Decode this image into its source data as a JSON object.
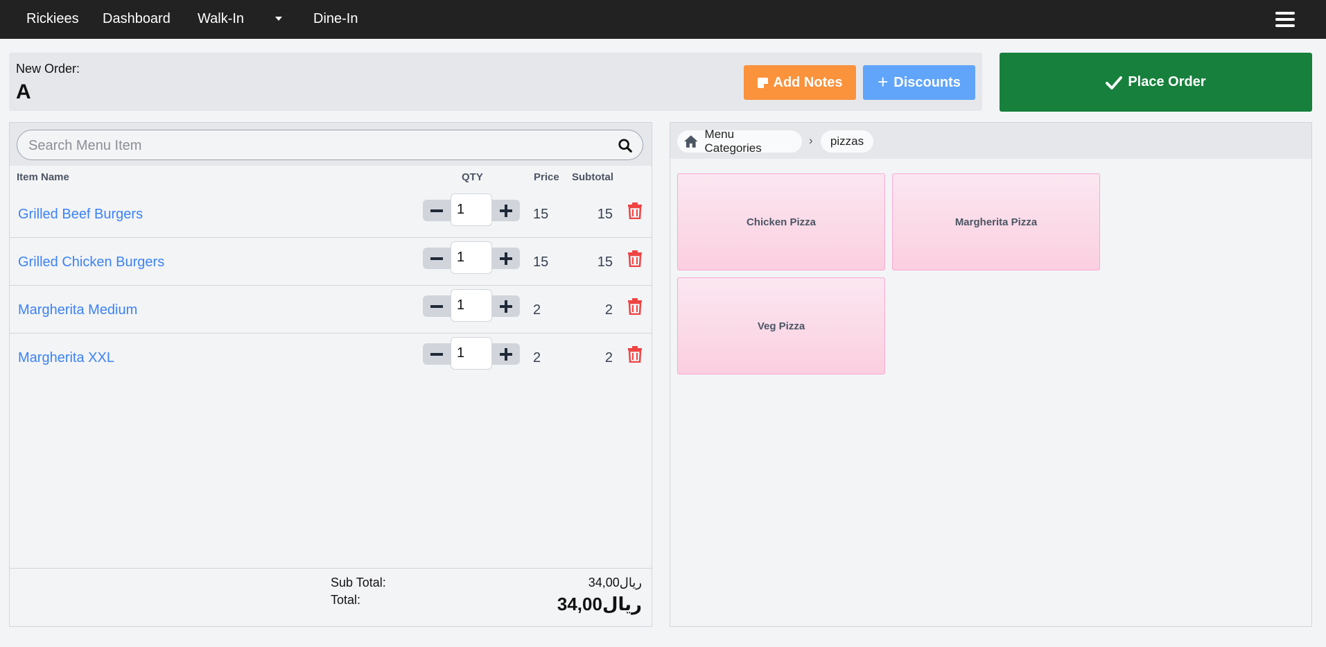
{
  "navbar": {
    "brand": "Rickiees",
    "links": [
      "Dashboard",
      "Walk-In",
      "Dine-In"
    ]
  },
  "order": {
    "label": "New Order:",
    "name": "A"
  },
  "actions": {
    "add_notes": "Add Notes",
    "discounts": "Discounts",
    "place_order": "Place Order"
  },
  "search": {
    "placeholder": "Search Menu Item"
  },
  "table": {
    "headers": {
      "item_name": "Item Name",
      "qty": "QTY",
      "price": "Price",
      "subtotal": "Subtotal"
    },
    "rows": [
      {
        "name": "Grilled Beef Burgers",
        "qty": "1",
        "price": "15",
        "subtotal": "15"
      },
      {
        "name": "Grilled Chicken Burgers",
        "qty": "1",
        "price": "15",
        "subtotal": "15"
      },
      {
        "name": "Margherita Medium",
        "qty": "1",
        "price": "2",
        "subtotal": "2"
      },
      {
        "name": "Margherita XXL",
        "qty": "1",
        "price": "2",
        "subtotal": "2"
      }
    ]
  },
  "totals": {
    "sub_total_label": "Sub Total:",
    "sub_total_value": "34,00ريال",
    "total_label": "Total:",
    "total_value": "34,00ريال"
  },
  "menu": {
    "breadcrumb_root": "Menu Categories",
    "breadcrumb_current": "pizzas",
    "items": [
      "Chicken Pizza",
      "Margherita Pizza",
      "Veg Pizza"
    ]
  },
  "colors": {
    "navbar": "#222222",
    "add_notes": "#fb923c",
    "discounts": "#60a5fa",
    "place_order": "#16803c",
    "item_link": "#3b82f6",
    "trash": "#ef4444"
  }
}
